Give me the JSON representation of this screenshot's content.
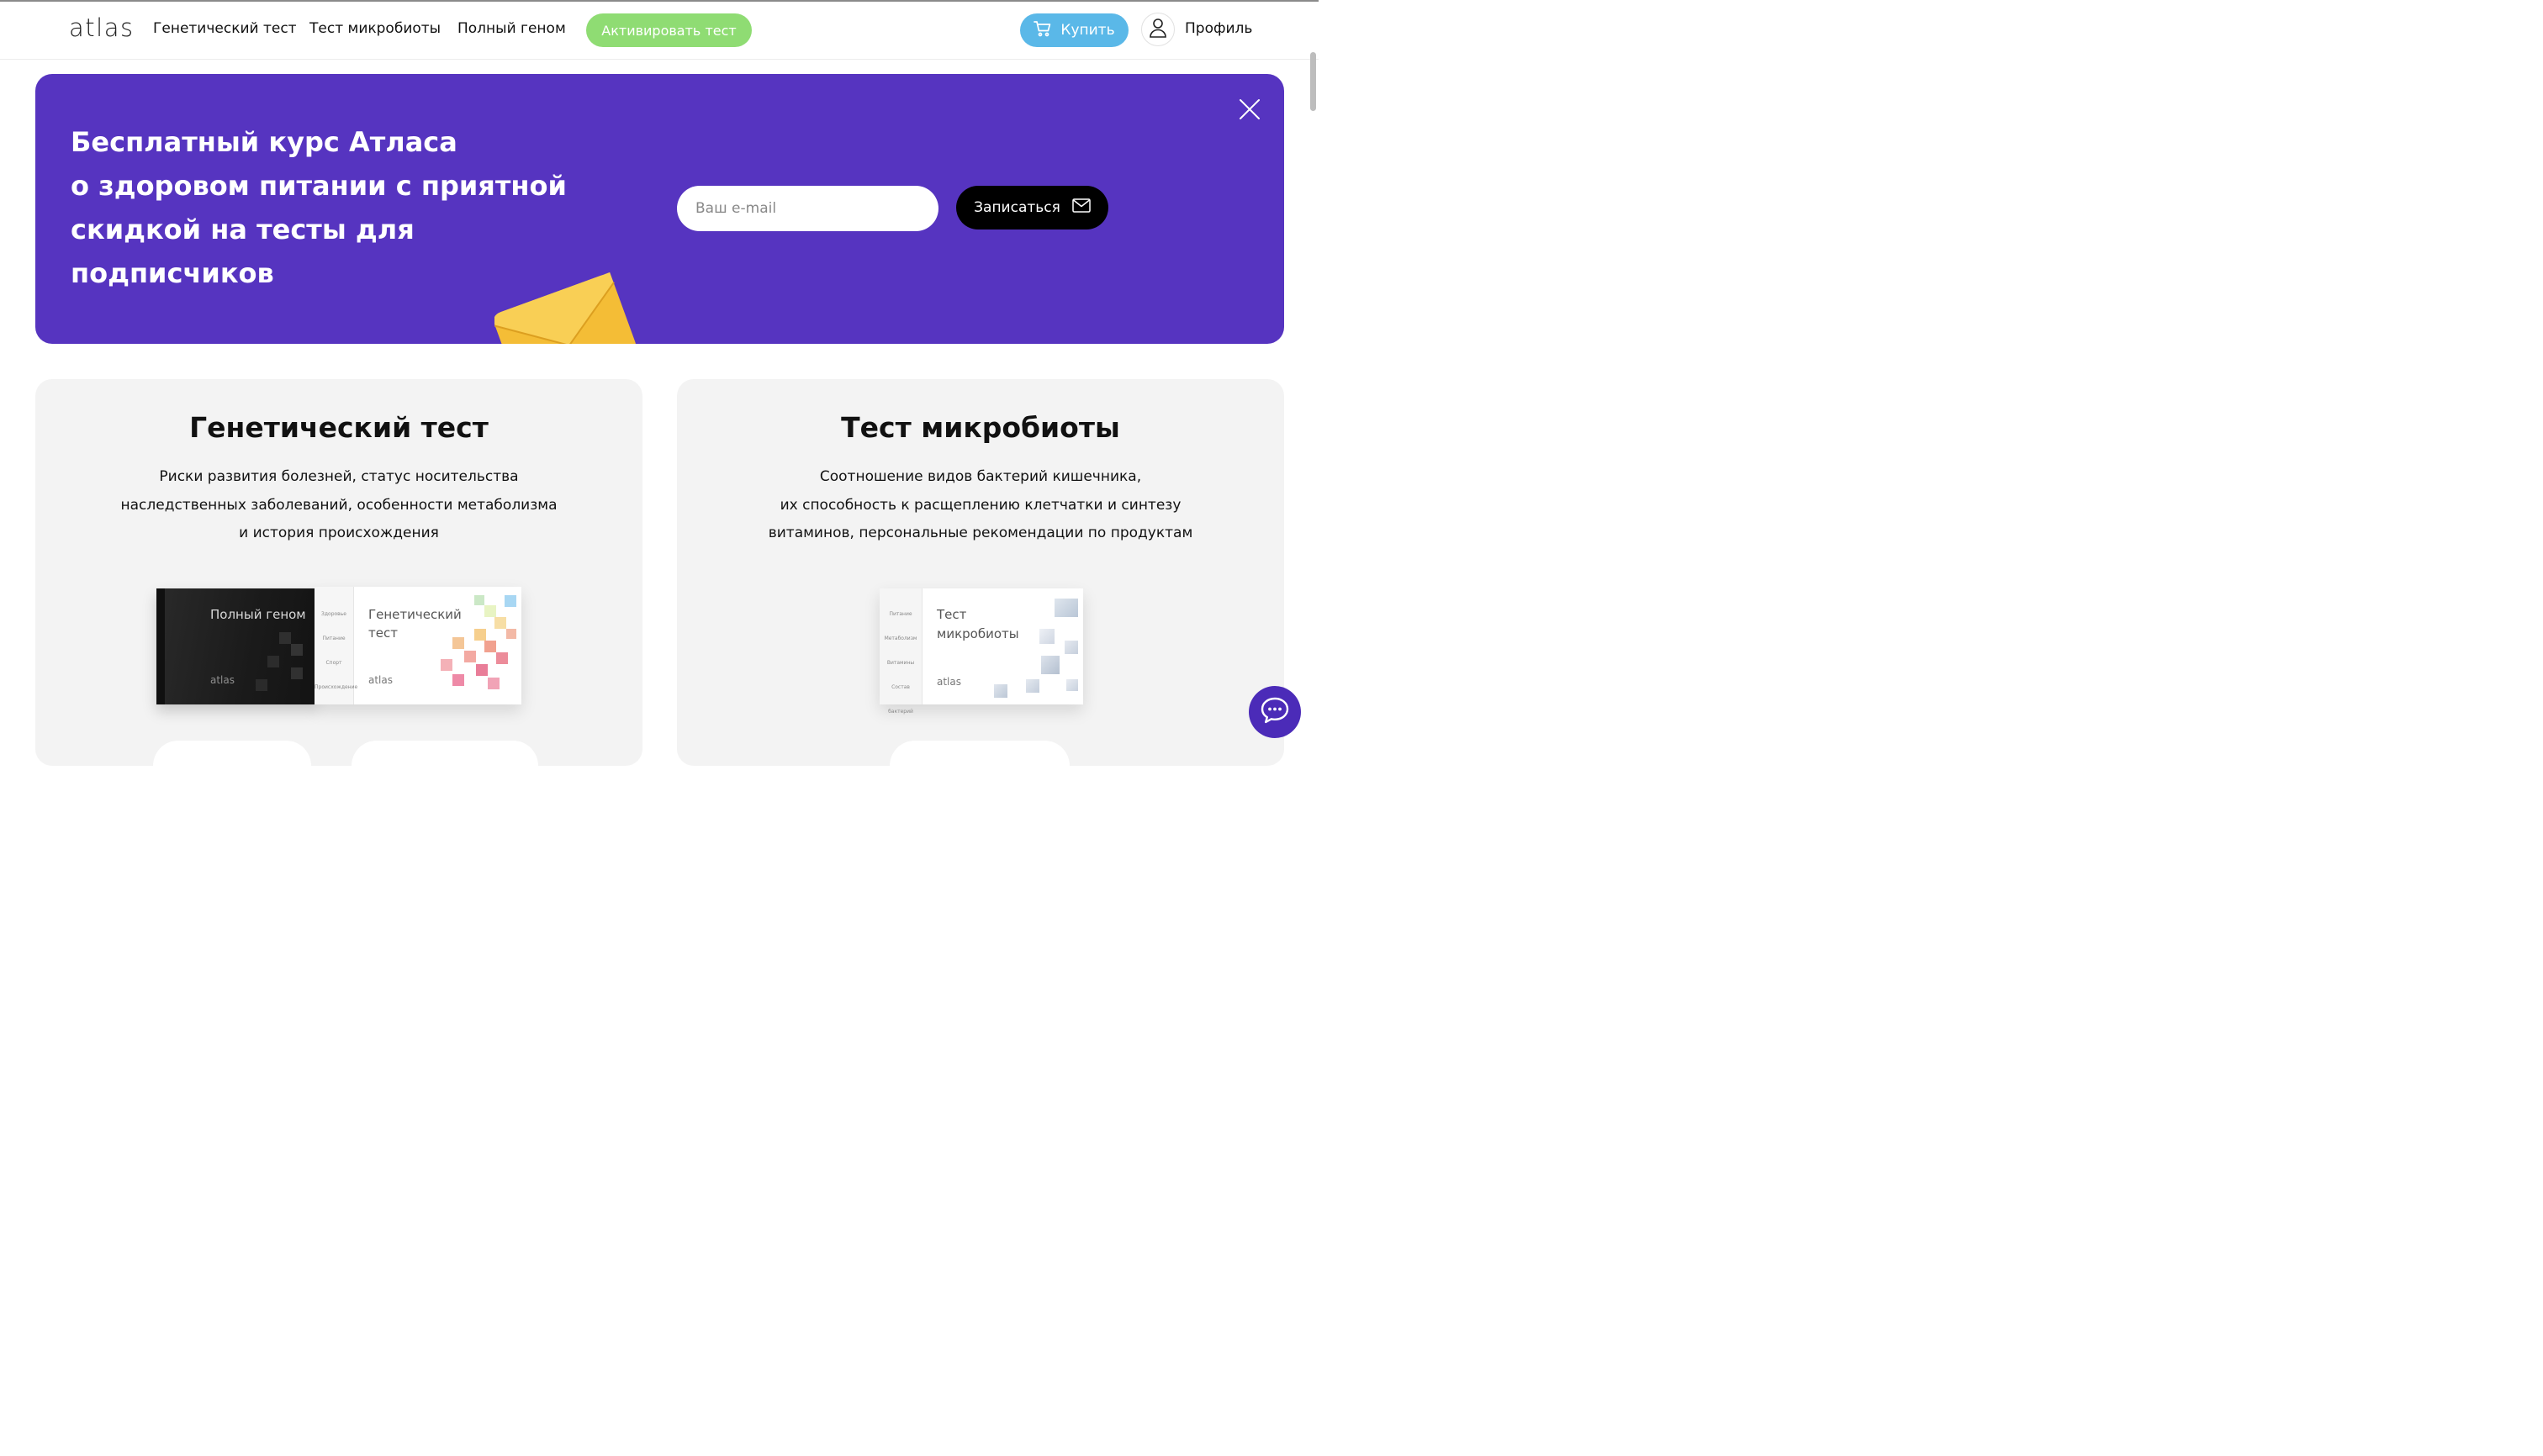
{
  "header": {
    "logo": "atlas",
    "nav": [
      "Генетический тест",
      "Тест микробиоты",
      "Полный геном"
    ],
    "activate_label": "Активировать тест",
    "buy_label": "Купить",
    "profile_label": "Профиль"
  },
  "promo": {
    "title_lines": [
      "Бесплатный курс Атласа",
      "о здоровом питании с приятной",
      "скидкой на тесты для",
      "подписчиков"
    ],
    "email_placeholder": "Ваш e-mail",
    "subscribe_label": "Записаться"
  },
  "cards": [
    {
      "title": "Генетический тест",
      "description_lines": [
        "Риски развития болезней, статус носительства",
        "наследственных заболеваний, особенности метаболизма",
        "и история происхождения"
      ],
      "products": [
        {
          "name": "Полный геном",
          "brand": "atlas",
          "color": "#1e1e1e",
          "side_labels": []
        },
        {
          "name_lines": [
            "Генетический",
            "тест"
          ],
          "brand": "atlas",
          "color": "#ffffff",
          "side_labels": [
            "Здоровье",
            "Питание",
            "Спорт",
            "Происхождение"
          ]
        }
      ]
    },
    {
      "title": "Тест микробиоты",
      "description_lines": [
        "Соотношение видов бактерий кишечника,",
        "их способность к расщеплению клетчатки и синтезу",
        "витаминов, персональные рекомендации по продуктам"
      ],
      "products": [
        {
          "name_lines": [
            "Тест",
            "микробиоты"
          ],
          "brand": "atlas",
          "color": "#ffffff",
          "side_labels": [
            "Питание",
            "Метаболизм",
            "Витамины",
            "Состав бактерий"
          ]
        }
      ]
    }
  ],
  "colors": {
    "promo_bg": "#5634c0",
    "activate_bg": "#8fdc73",
    "buy_bg": "#5ab8e8",
    "envelope": "#f5c136",
    "chat_bg": "#4b2bb8"
  },
  "icons": [
    "cart-icon",
    "user-icon",
    "close-icon",
    "mail-icon",
    "envelope-illustration",
    "chat-icon"
  ]
}
